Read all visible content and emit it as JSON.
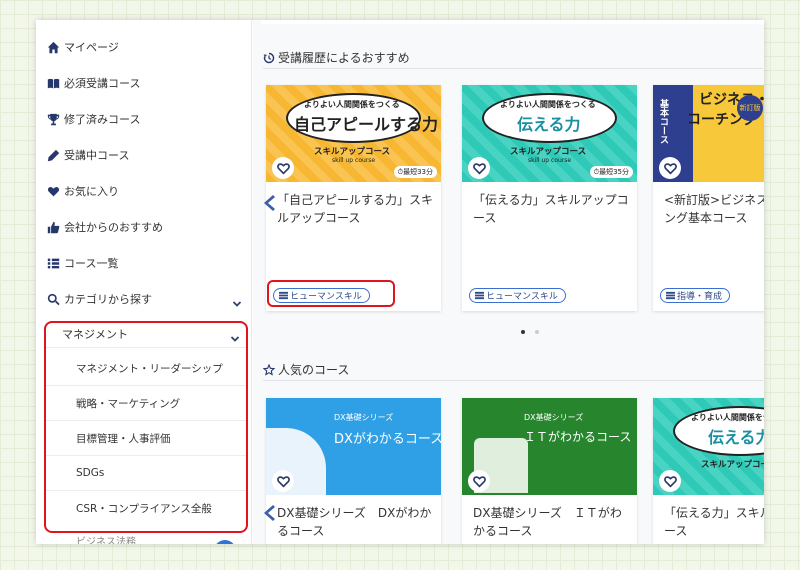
{
  "sidebar": {
    "items": [
      {
        "label": "マイページ",
        "icon": "home-icon"
      },
      {
        "label": "必須受講コース",
        "icon": "book-icon"
      },
      {
        "label": "修了済みコース",
        "icon": "trophy-icon"
      },
      {
        "label": "受講中コース",
        "icon": "pencil-icon"
      },
      {
        "label": "お気に入り",
        "icon": "heart-icon"
      },
      {
        "label": "会社からのおすすめ",
        "icon": "thumbs-up-icon"
      },
      {
        "label": "コース一覧",
        "icon": "list-icon"
      }
    ],
    "category": {
      "label": "カテゴリから探す",
      "icon": "search-icon"
    },
    "management": {
      "header": "マネジメント",
      "items": [
        "マネジメント・リーダーシップ",
        "戦略・マーケティング",
        "目標管理・人事評価",
        "SDGs",
        "CSR・コンプライアンス全般"
      ]
    },
    "partial_item": "ビジネス法務"
  },
  "sections": {
    "recommend_title": "受講履歴によるおすすめ",
    "popular_title": "人気のコース"
  },
  "recommend_cards": [
    {
      "thumb_small": "よりよい人間関係をつくる",
      "thumb_big": "自己アピールする力",
      "thumb_course": "スキルアップコース",
      "thumb_en": "skill up course",
      "time": "最短33分",
      "title": "「自己アピールする力」スキルアップコース",
      "tag": "ヒューマンスキル"
    },
    {
      "thumb_small": "よりよい人間関係をつくる",
      "thumb_big": "伝える力",
      "thumb_course": "スキルアップコース",
      "thumb_en": "skill up course",
      "time": "最短35分",
      "title": "「伝える力」スキルアップコース",
      "tag": "ヒューマンスキル"
    },
    {
      "thumb_small": "ビジネス・",
      "thumb_big": "コーチング",
      "thumb_course": "基本コース",
      "thumb_en": "新訂版",
      "time": "",
      "title": "<新訂版>ビジネス・コーチング基本コース",
      "tag": "指導・育成"
    }
  ],
  "popular_cards": [
    {
      "thumb_small": "DX基礎シリーズ",
      "thumb_big": "DXがわかるコース",
      "title": "DX基礎シリーズ　DXがわかるコース"
    },
    {
      "thumb_small": "DX基礎シリーズ",
      "thumb_big": "ＩＴがわかるコース",
      "title": "DX基礎シリーズ　ＩＴがわかるコース"
    },
    {
      "thumb_small": "よりよい人間関係をつくる",
      "thumb_big": "伝える力",
      "thumb_course": "スキルアップコース",
      "title": "「伝える力」スキルアップコース"
    }
  ],
  "colors": {
    "accent": "#2f72d8",
    "highlight": "#e0141e",
    "navy": "#26376b"
  }
}
